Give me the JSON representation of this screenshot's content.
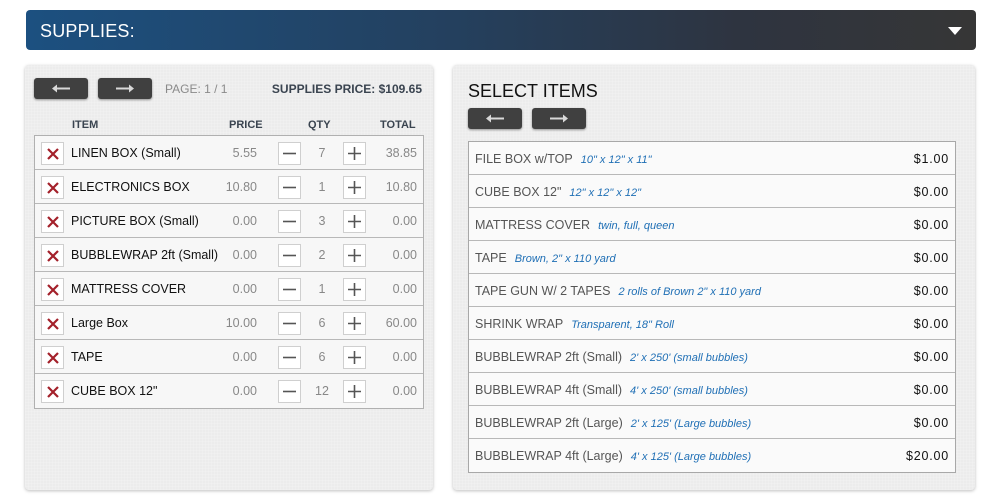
{
  "header": {
    "title": "SUPPLIES:",
    "toggle_icon": "caret-down-icon"
  },
  "cart": {
    "page_label": "PAGE: 1 / 1",
    "supplies_price_label": "SUPPLIES PRICE: $109.65",
    "prev_icon": "arrow-left-icon",
    "next_icon": "arrow-right-icon",
    "columns": {
      "item": "ITEM",
      "price": "PRICE",
      "qty": "QTY",
      "total": "TOTAL"
    },
    "rows": [
      {
        "name": "LINEN BOX (Small)",
        "price": "5.55",
        "qty": "7",
        "total": "38.85"
      },
      {
        "name": "ELECTRONICS BOX",
        "price": "10.80",
        "qty": "1",
        "total": "10.80"
      },
      {
        "name": "PICTURE BOX (Small)",
        "price": "0.00",
        "qty": "3",
        "total": "0.00"
      },
      {
        "name": "BUBBLEWRAP 2ft (Small)",
        "price": "0.00",
        "qty": "2",
        "total": "0.00"
      },
      {
        "name": "MATTRESS COVER",
        "price": "0.00",
        "qty": "1",
        "total": "0.00"
      },
      {
        "name": "Large Box",
        "price": "10.00",
        "qty": "6",
        "total": "60.00"
      },
      {
        "name": "TAPE",
        "price": "0.00",
        "qty": "6",
        "total": "0.00"
      },
      {
        "name": "CUBE BOX 12\"",
        "price": "0.00",
        "qty": "12",
        "total": "0.00"
      }
    ],
    "colors": {
      "remove_icon": "#a3202a",
      "nav_button": "#404040"
    }
  },
  "catalog": {
    "title": "SELECT ITEMS",
    "items": [
      {
        "name": "FILE BOX w/TOP",
        "desc": "10\" x 12\" x 11\"",
        "price": "$1.00"
      },
      {
        "name": "CUBE BOX 12\"",
        "desc": "12\" x 12\" x 12\"",
        "price": "$0.00"
      },
      {
        "name": "MATTRESS COVER",
        "desc": "twin, full, queen",
        "price": "$0.00"
      },
      {
        "name": "TAPE",
        "desc": "Brown, 2\" x 110 yard",
        "price": "$0.00"
      },
      {
        "name": "TAPE GUN W/ 2 TAPES",
        "desc": "2 rolls of Brown 2\" x 110 yard",
        "price": "$0.00"
      },
      {
        "name": "SHRINK WRAP",
        "desc": "Transparent, 18\" Roll",
        "price": "$0.00"
      },
      {
        "name": "BUBBLEWRAP 2ft (Small)",
        "desc": "2' x 250' (small bubbles)",
        "price": "$0.00"
      },
      {
        "name": "BUBBLEWRAP 4ft (Small)",
        "desc": "4' x 250' (small bubbles)",
        "price": "$0.00"
      },
      {
        "name": "BUBBLEWRAP 2ft (Large)",
        "desc": "2' x 125' (Large bubbles)",
        "price": "$0.00"
      },
      {
        "name": "BUBBLEWRAP 4ft (Large)",
        "desc": "4' x 125' (Large bubbles)",
        "price": "$20.00"
      }
    ],
    "colors": {
      "desc": "#1f6fb5"
    }
  }
}
